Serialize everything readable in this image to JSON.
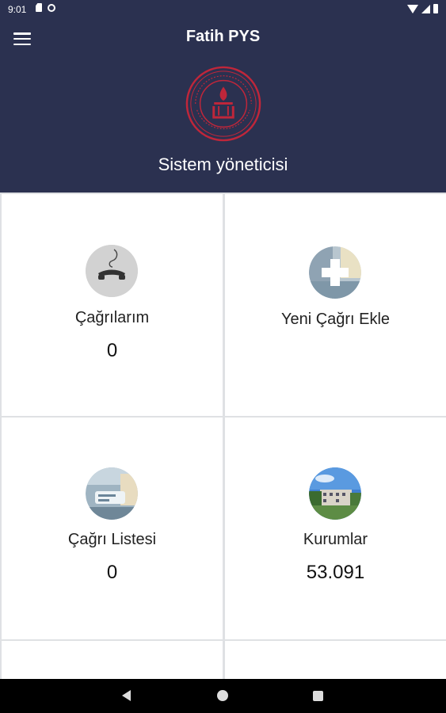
{
  "status_bar": {
    "time": "9:01"
  },
  "header": {
    "title": "Fatih PYS",
    "subtitle": "Sistem yöneticisi"
  },
  "tiles": [
    {
      "label": "Çağrılarım",
      "count": "0",
      "icon": "phone-icon"
    },
    {
      "label": "Yeni Çağrı Ekle",
      "count": "",
      "icon": "add-icon"
    },
    {
      "label": "Çağrı Listesi",
      "count": "0",
      "icon": "list-icon"
    },
    {
      "label": "Kurumlar",
      "count": "53.091",
      "icon": "building-icon"
    }
  ],
  "colors": {
    "header_bg": "#2b3150",
    "logo_red": "#c0263a"
  }
}
